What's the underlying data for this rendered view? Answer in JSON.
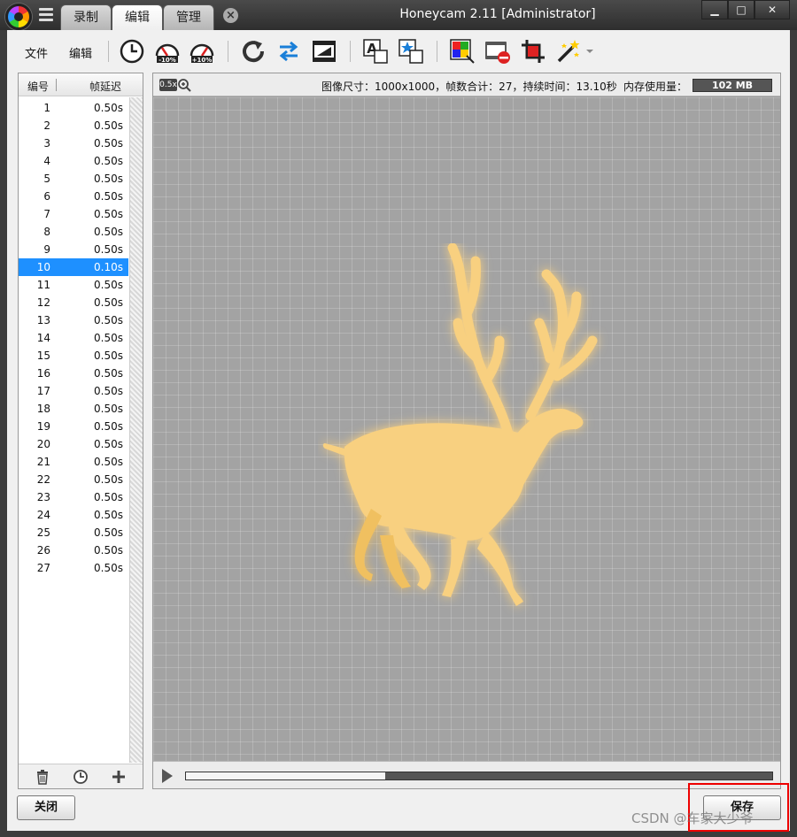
{
  "titlebar": {
    "title": "Honeycam 2.11 [Administrator]",
    "tabs": [
      {
        "label": "录制"
      },
      {
        "label": "编辑"
      },
      {
        "label": "管理"
      }
    ],
    "window_buttons": {
      "minimize": "▁",
      "maximize": "□",
      "close": "✕"
    }
  },
  "toolbar": {
    "file_label": "文件",
    "edit_label": "编辑",
    "icons": [
      "clock-icon",
      "speed-minus-10-icon",
      "speed-plus-10-icon",
      "rotate-icon",
      "swap-icon",
      "film-edit-icon",
      "text-icon",
      "sticker-icon",
      "color-filter-icon",
      "remove-frames-icon",
      "crop-icon",
      "magic-wand-icon"
    ],
    "speed_minus_text": "-10%",
    "speed_plus_text": "+10%"
  },
  "frame_list": {
    "col_number": "编号",
    "col_delay": "帧延迟",
    "selected_index": 10,
    "rows": [
      {
        "n": "1",
        "d": "0.50s"
      },
      {
        "n": "2",
        "d": "0.50s"
      },
      {
        "n": "3",
        "d": "0.50s"
      },
      {
        "n": "4",
        "d": "0.50s"
      },
      {
        "n": "5",
        "d": "0.50s"
      },
      {
        "n": "6",
        "d": "0.50s"
      },
      {
        "n": "7",
        "d": "0.50s"
      },
      {
        "n": "8",
        "d": "0.50s"
      },
      {
        "n": "9",
        "d": "0.50s"
      },
      {
        "n": "10",
        "d": "0.10s"
      },
      {
        "n": "11",
        "d": "0.50s"
      },
      {
        "n": "12",
        "d": "0.50s"
      },
      {
        "n": "13",
        "d": "0.50s"
      },
      {
        "n": "14",
        "d": "0.50s"
      },
      {
        "n": "15",
        "d": "0.50s"
      },
      {
        "n": "16",
        "d": "0.50s"
      },
      {
        "n": "17",
        "d": "0.50s"
      },
      {
        "n": "18",
        "d": "0.50s"
      },
      {
        "n": "19",
        "d": "0.50s"
      },
      {
        "n": "20",
        "d": "0.50s"
      },
      {
        "n": "21",
        "d": "0.50s"
      },
      {
        "n": "22",
        "d": "0.50s"
      },
      {
        "n": "23",
        "d": "0.50s"
      },
      {
        "n": "24",
        "d": "0.50s"
      },
      {
        "n": "25",
        "d": "0.50s"
      },
      {
        "n": "26",
        "d": "0.50s"
      },
      {
        "n": "27",
        "d": "0.50s"
      }
    ]
  },
  "preview": {
    "zoom": "0.5x",
    "info": "图像尺寸：1000x1000，帧数合计：27，持续时间：13.10秒",
    "memory_label": "内存使用量：",
    "memory_value": "102 MB",
    "playback_progress": 0.34,
    "deer_color": "#f8d080"
  },
  "buttons": {
    "close_label": "关闭",
    "save_label": "保存"
  },
  "watermark": "CSDN @车家大少爷"
}
